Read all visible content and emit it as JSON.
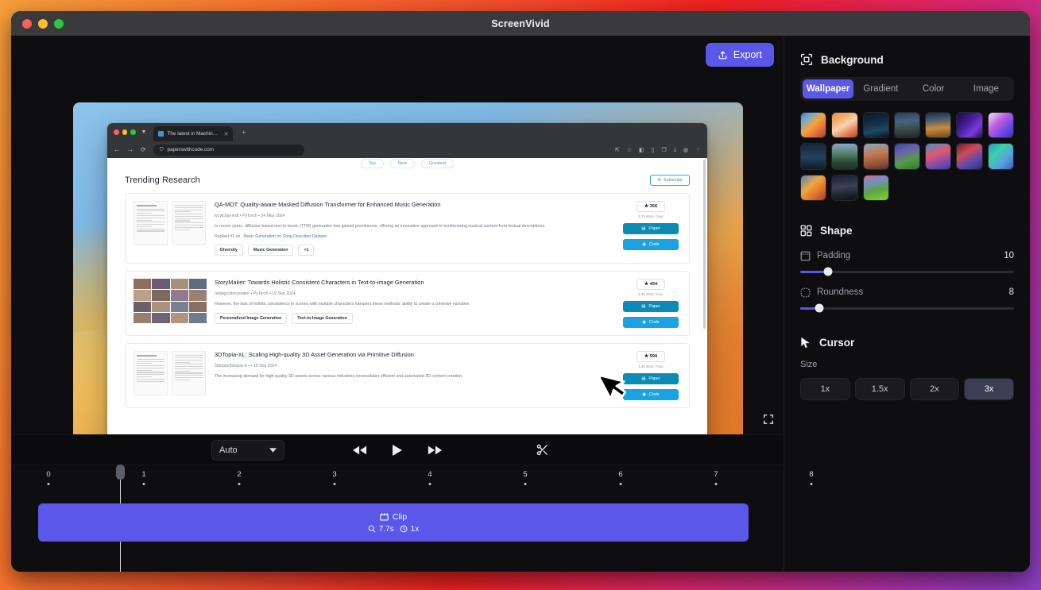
{
  "window": {
    "app_title": "ScreenVivid",
    "traffic_lights": [
      "close-red",
      "minimize-yellow",
      "maximize-green"
    ]
  },
  "toolbar": {
    "export_label": "Export",
    "export_icon": "upload-icon",
    "export_color": "#5b57e8"
  },
  "preview": {
    "fullscreen_icon": "fullscreen-icon",
    "cursor_icon": "mouse-pointer-icon",
    "browser": {
      "tab_title": "The latest in Machine L...",
      "new_tab_label": "+",
      "url": "paperswithcode.com",
      "nav_icons": [
        "back-arrow-icon",
        "forward-arrow-icon",
        "reload-icon"
      ],
      "page": {
        "filter_pills": [
          "Top",
          "New",
          "Greatest"
        ],
        "heading": "Trending Research",
        "subscribe_label": "Subscribe",
        "papers": [
          {
            "title": "QA-MDT: Quality-aware Masked Diffusion Transformer for Enhanced Music Generation",
            "meta": "ivcylc/qa-mdt  •  PyTorch  •  24 May 2024",
            "abstract": "In recent years, diffusion-based text-to-music (TTM) generation has gained prominence, offering an innovative approach to synthesizing musical content from textual descriptions.",
            "rank_prefix": "Ranked #1 on",
            "rank_link": "Music Generation on Song Describer Dataset",
            "tags": [
              "Diversity",
              "Music Generation",
              "+1"
            ],
            "stars": "356",
            "rate": "3.33 stars / hour",
            "paper_label": "Paper",
            "code_label": "Code",
            "thumb_type": "document"
          },
          {
            "title": "StoryMaker: Towards Holistic Consistent Characters in Text-to-image Generation",
            "meta": "redaigc/storymaker  •  PyTorch  •  19 Sep 2024",
            "abstract": "However, the lack of holistic consistency in scenes with multiple characters hampers these methods' ability to create a cohesive narrative.",
            "rank_prefix": "",
            "rank_link": "",
            "tags": [
              "Personalized Image Generation",
              "Text-to-Image Generation"
            ],
            "stars": "434",
            "rate": "3.43 stars / hour",
            "paper_label": "Paper",
            "code_label": "Code",
            "thumb_type": "photo-grid"
          },
          {
            "title": "3DTopia-XL: Scaling High-quality 3D Asset Generation via Primitive Diffusion",
            "meta": "3dtopia/3dtopia-xl  •  •  19 Sep 2024",
            "abstract": "The increasing demand for high-quality 3D assets across various industries necessitates efficient and automated 3D content creation.",
            "rank_prefix": "",
            "rank_link": "",
            "tags": [],
            "stars": "599",
            "rate": "1.36 stars / hour",
            "paper_label": "Paper",
            "code_label": "Code",
            "thumb_type": "document"
          }
        ]
      }
    }
  },
  "transport": {
    "zoom_select_value": "Auto",
    "zoom_select_icon": "chevron-down-icon",
    "rewind_icon": "rewind-icon",
    "play_icon": "play-icon",
    "forward_icon": "fast-forward-icon",
    "cut_icon": "scissors-icon"
  },
  "timeline": {
    "ticks": [
      "0",
      "1",
      "2",
      "3",
      "4",
      "5",
      "6",
      "7",
      "8"
    ],
    "playhead_position": "1",
    "clip": {
      "label": "Clip",
      "label_icon": "film-icon",
      "duration": "7.7s",
      "duration_icon": "magnifier-icon",
      "speed": "1x",
      "speed_icon": "clock-icon",
      "color": "#5b57e8"
    }
  },
  "panel": {
    "background": {
      "title": "Background",
      "icon": "background-icon",
      "tabs": [
        "Wallpaper",
        "Gradient",
        "Color",
        "Image"
      ],
      "active_tab": "Wallpaper",
      "wallpapers": [
        {
          "name": "ventura-orange",
          "css": "linear-gradient(140deg,#3d7bbf 0%,#6aa8dd 20%,#f0a63c 48%,#e8763a 70%,#b03f2e 100%)"
        },
        {
          "name": "ventura-peach",
          "css": "linear-gradient(150deg,#e98e3b 0%,#f2b06b 28%,#f6d2b5 50%,#e07a46 78%,#b8452c 100%)"
        },
        {
          "name": "big-sur-night",
          "css": "linear-gradient(170deg,#0c1826 0%,#15304a 45%,#1d4a63 70%,#0a1420 100%)"
        },
        {
          "name": "catalina-island",
          "css": "linear-gradient(175deg,#2b3f62 0%,#4a6285 35%,#3a4f4a 62%,#20262c 100%)"
        },
        {
          "name": "mojave-dune",
          "css": "linear-gradient(175deg,#1b2a47 0%,#4d5d6e 30%,#c98b3c 62%,#6d4a20 100%)"
        },
        {
          "name": "purple-aurora",
          "css": "linear-gradient(135deg,#1a0b3a 0%,#4b1f9e 45%,#7a3ae0 70%,#2a1255 100%)"
        },
        {
          "name": "magenta-wave",
          "css": "linear-gradient(135deg,#e9e3f5 0%,#c05ae0 40%,#6a4ae8 70%,#3f2fa8 100%)"
        },
        {
          "name": "macos-dark-island",
          "css": "linear-gradient(180deg,#16263a 0%,#23415e 55%,#0e1a28 100%)"
        },
        {
          "name": "lake-landscape",
          "css": "linear-gradient(180deg,#86a8cc 0%,#4f7a58 45%,#2c4a3a 70%,#1d3028 100%)"
        },
        {
          "name": "canyon-rocks",
          "css": "linear-gradient(170deg,#8aa6c0 0%,#c47a52 40%,#9a5a3c 70%,#5c3424 100%)"
        },
        {
          "name": "green-hills",
          "css": "linear-gradient(160deg,#2f4f8a 0%,#6a5fb0 30%,#5a9a4a 62%,#2f7a30 100%)"
        },
        {
          "name": "sonoma-waves",
          "css": "linear-gradient(160deg,#4a8ed0 0%,#e05a6a 40%,#8a4ab0 70%,#2f4a9a 100%)"
        },
        {
          "name": "red-ribbon",
          "css": "linear-gradient(150deg,#6a1f2a 0%,#d04a5a 35%,#5a4ab0 68%,#2a2f6a 100%)"
        },
        {
          "name": "teal-beams",
          "css": "linear-gradient(135deg,#2a9ad0 0%,#3ad0a8 35%,#5aa0e0 65%,#3a60c0 100%)"
        },
        {
          "name": "ventura-orange-2",
          "css": "linear-gradient(140deg,#4a86c4 0%,#f0a63c 40%,#e0702e 70%,#a33a28 100%)"
        },
        {
          "name": "mountain-night",
          "css": "linear-gradient(175deg,#1a1f33 0%,#3a4256 45%,#20242f 75%,#101219 100%)"
        },
        {
          "name": "sonoma-green",
          "css": "linear-gradient(165deg,#e06a6a 0%,#7a8ad0 25%,#5aa83a 60%,#8ad03a 100%)"
        }
      ]
    },
    "shape": {
      "title": "Shape",
      "icon": "shape-icon",
      "padding": {
        "label": "Padding",
        "icon": "padding-icon",
        "value": "10",
        "percent": 13
      },
      "roundness": {
        "label": "Roundness",
        "icon": "roundness-icon",
        "value": "8",
        "percent": 9
      }
    },
    "cursor": {
      "title": "Cursor",
      "icon": "cursor-icon",
      "size_label": "Size",
      "sizes": [
        "1x",
        "1.5x",
        "2x",
        "3x"
      ],
      "active_size": "3x"
    }
  }
}
